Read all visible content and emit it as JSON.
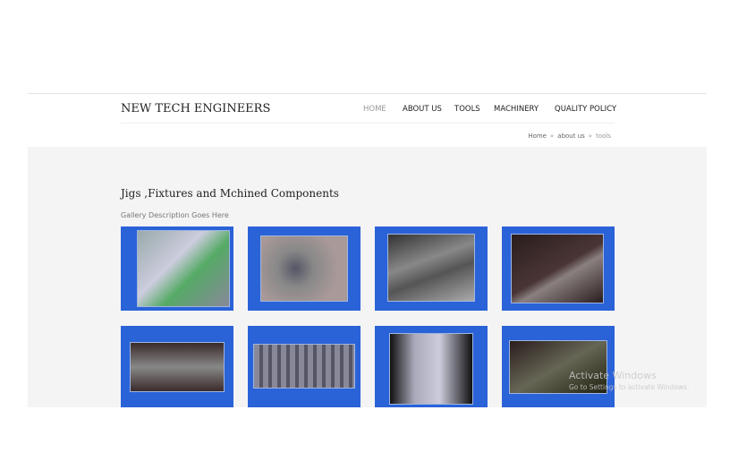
{
  "header": {
    "brand": "NEW TECH ENGINEERS",
    "nav": [
      {
        "label": "HOME",
        "active": true
      },
      {
        "label": "ABOUT US"
      },
      {
        "label": "TOOLS"
      },
      {
        "label": "MACHINERY"
      },
      {
        "label": "QUALITY POLICY"
      }
    ]
  },
  "breadcrumb": {
    "items": [
      "Home",
      "about us",
      "tools"
    ],
    "separator": "»"
  },
  "gallery": {
    "title": "Jigs ,Fixtures and Mchined Components",
    "description": "Gallery Description Goes Here",
    "tile_color": "#2a62d8",
    "images": [
      "machine",
      "bolts",
      "plates",
      "bracket",
      "stamped-part",
      "pins",
      "block",
      "fixture"
    ]
  },
  "watermark": {
    "title": "Activate Windows",
    "subtitle": "Go to Settings to activate Windows."
  }
}
